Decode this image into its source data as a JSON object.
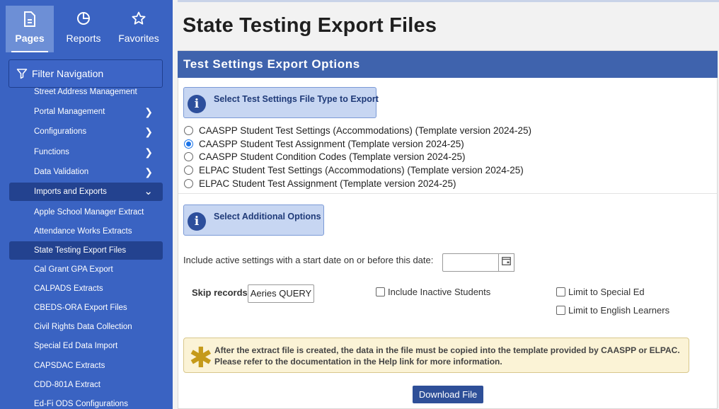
{
  "topnav": {
    "pages": "Pages",
    "reports": "Reports",
    "favorites": "Favorites"
  },
  "filter": {
    "placeholder": "Filter Navigation"
  },
  "sidebar": {
    "items": [
      {
        "label": "Street Address Management"
      },
      {
        "label": "Portal Management"
      },
      {
        "label": "Configurations"
      },
      {
        "label": "Functions"
      },
      {
        "label": "Data Validation"
      },
      {
        "label": "Imports and Exports"
      },
      {
        "label": "Apple School Manager Extract"
      },
      {
        "label": "Attendance Works Extracts"
      },
      {
        "label": "State Testing Export Files"
      },
      {
        "label": "Cal Grant GPA Export"
      },
      {
        "label": "CALPADS Extracts"
      },
      {
        "label": "CBEDS-ORA Export Files"
      },
      {
        "label": "Civil Rights Data Collection"
      },
      {
        "label": "Special Ed Data Import"
      },
      {
        "label": "CAPSDAC Extracts"
      },
      {
        "label": "CDD-801A Extract"
      },
      {
        "label": "Ed-Fi ODS Configurations"
      }
    ]
  },
  "page": {
    "title": "State Testing Export Files",
    "section_title": "Test Settings Export Options"
  },
  "file_type": {
    "info_label": "Select Test Settings File Type to Export",
    "options": [
      {
        "label": "CAASPP Student Test Settings (Accommodations) (Template version 2024-25)",
        "selected": false
      },
      {
        "label": "CAASPP Student Test Assignment (Template version 2024-25)",
        "selected": true
      },
      {
        "label": "CAASPP Student Condition Codes (Template version 2024-25)",
        "selected": false
      },
      {
        "label": "ELPAC Student Test Settings (Accommodations) (Template version 2024-25)",
        "selected": false
      },
      {
        "label": "ELPAC Student Test Assignment (Template version 2024-25)",
        "selected": false
      }
    ]
  },
  "additional": {
    "info_label": "Select Additional Options",
    "date_label": "Include active settings with a start date on or before this date:",
    "date_value": "",
    "skip_label": "Skip records:",
    "skip_button": "Aeries QUERY",
    "include_inactive": "Include Inactive Students",
    "limit_special_ed": "Limit to Special Ed",
    "limit_english": "Limit to English Learners"
  },
  "notice": {
    "line1": "After the extract file is created, the data in the file must be copied into the template provided by CAASPP or ELPAC.",
    "line2": "Please refer to the documentation in the Help link for more information."
  },
  "download_label": "Download File",
  "colors": {
    "sidebar": "#3a63c2",
    "section_header": "#3f63ad",
    "button": "#2e4f98"
  }
}
